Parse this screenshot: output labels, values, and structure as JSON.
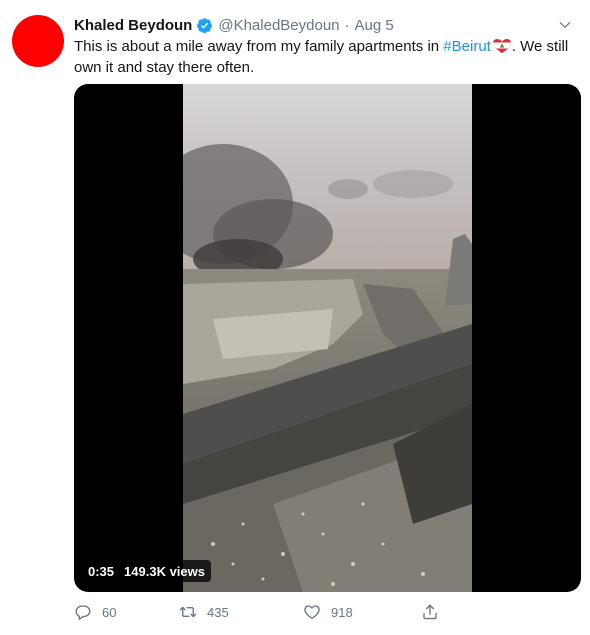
{
  "tweet": {
    "author_name": "Khaled Beydoun",
    "handle": "@KhaledBeydoun",
    "separator": "·",
    "date": "Aug 5",
    "text_before": "This is about a mile away from my family apartments in ",
    "hashtag": "#Beirut",
    "text_after": ".  We still own it and stay there often.",
    "avatar_color": "#ff0000"
  },
  "media": {
    "duration": "0:35",
    "views": "149.3K views"
  },
  "actions": {
    "replies": "60",
    "retweets": "435",
    "likes": "918"
  },
  "icons": [
    "verified-icon",
    "chevron-down-icon",
    "lebanon-heart-flag-icon",
    "reply-icon",
    "retweet-icon",
    "like-icon",
    "share-icon"
  ],
  "colors": {
    "link": "#1b95e0",
    "secondary_text": "#657786",
    "verified": "#1da1f2"
  }
}
